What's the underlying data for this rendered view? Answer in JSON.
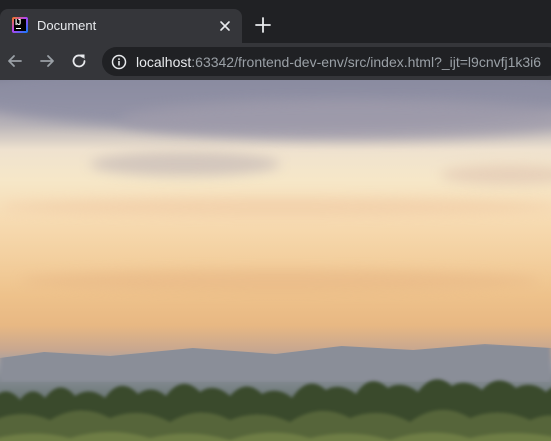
{
  "tab": {
    "title": "Document"
  },
  "address_bar": {
    "host": "localhost",
    "rest": ":63342/frontend-dev-env/src/index.html?_ijt=l9cnvfj1k3i6"
  },
  "page": {
    "background_image": "blurred sunset sky over treeline"
  },
  "colors": {
    "tab_strip": "#202124",
    "toolbar": "#35363a",
    "omnibox": "#202124",
    "text_primary": "#e8eaed",
    "text_secondary": "#9aa0a6"
  }
}
